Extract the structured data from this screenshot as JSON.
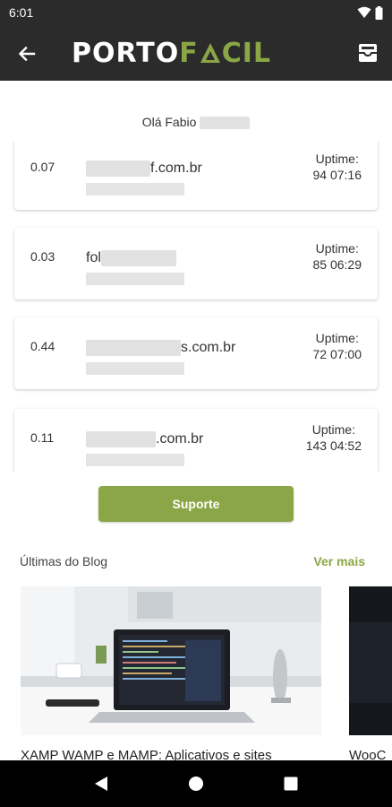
{
  "status_bar": {
    "time": "6:01"
  },
  "app_bar": {
    "logo_part1": "PORTO",
    "logo_part2": "F",
    "logo_part3": "CIL"
  },
  "greeting": "Olá Fabio",
  "uptime_label": "Uptime:",
  "servers": [
    {
      "load": "0.07",
      "domain_visible": "f.com.br",
      "uptime": "94 07:16"
    },
    {
      "load": "0.03",
      "domain_visible": "fol",
      "uptime": "85 06:29"
    },
    {
      "load": "0.44",
      "domain_visible": "s.com.br",
      "uptime": "72 07:00"
    },
    {
      "load": "0.11",
      "domain_visible": ".com.br",
      "uptime": "143 04:52"
    }
  ],
  "support_label": "Suporte",
  "blog": {
    "title": "Últimas do Blog",
    "more_label": "Ver mais",
    "posts": [
      {
        "caption": "XAMP WAMP e MAMP: Aplicativos e sites"
      },
      {
        "caption": "WooC"
      }
    ]
  },
  "colors": {
    "accent": "#8ba646",
    "bar": "#2b2b2b"
  }
}
